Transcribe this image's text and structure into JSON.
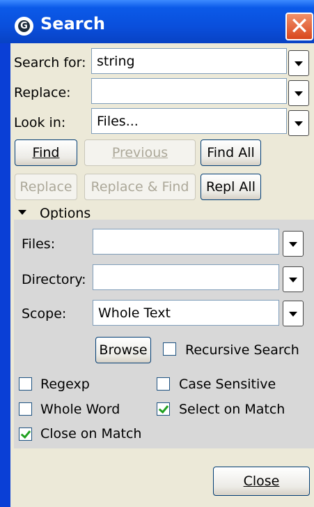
{
  "window": {
    "title": "Search"
  },
  "search": {
    "search_for_label": "Search for:",
    "search_for_value": "string",
    "replace_label": "Replace:",
    "replace_value": "",
    "look_in_label": "Look in:",
    "look_in_value": "Files..."
  },
  "buttons": {
    "find": "Find",
    "previous": "Previous",
    "find_all": "Find All",
    "replace": "Replace",
    "replace_find": "Replace & Find",
    "repl_all": "Repl All",
    "browse": "Browse",
    "close": "Close"
  },
  "options": {
    "header": "Options",
    "files_label": "Files:",
    "files_value": "",
    "directory_label": "Directory:",
    "directory_value": "",
    "scope_label": "Scope:",
    "scope_value": "Whole Text",
    "recursive_search": {
      "label": "Recursive Search",
      "checked": false
    },
    "regexp": {
      "label": "Regexp",
      "checked": false
    },
    "case_sensitive": {
      "label": "Case Sensitive",
      "checked": false
    },
    "whole_word": {
      "label": "Whole Word",
      "checked": false
    },
    "select_on_match": {
      "label": "Select on Match",
      "checked": true
    },
    "close_on_match": {
      "label": "Close on Match",
      "checked": true
    }
  }
}
